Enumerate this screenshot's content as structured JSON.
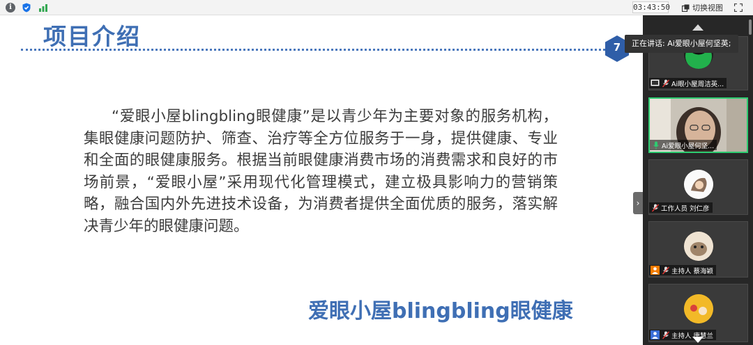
{
  "topbar": {
    "info_icon": "info-icon",
    "shield_icon": "shield-icon",
    "signal_icon": "signal-icon",
    "time": "03:43:50",
    "switch_view_label": "切换视图",
    "fullscreen_icon": "fullscreen-icon"
  },
  "slide": {
    "title": "项目介绍",
    "page_number": "7",
    "body": "“爱眼小屋blingbling眼健康”是以青少年为主要对象的服务机构，集眼健康问题防护、筛查、治疗等全方位服务于一身，提供健康、专业和全面的眼健康服务。根据当前眼健康消费市场的消费需求和良好的市场前景，“爱眼小屋”采用现代化管理模式，建立极具影响力的营销策略，融合国内外先进技术设备，为消费者提供全面优质的服务，落实解决青少年的眼健康问题。",
    "brand": "爱眼小屋blingbling眼健康",
    "colors": {
      "title": "#3f6fb4",
      "text": "#3c3c3c"
    }
  },
  "speaking": "正在讲话: Ai爱眼小屋何坚英;",
  "participants": [
    {
      "name": "Ai眼小屋周洁英...",
      "mic": "muted",
      "badge": "screen-share-icon"
    },
    {
      "name": "Ai爱眼小屋何坚...",
      "mic": "active",
      "badge": ""
    },
    {
      "name": "工作人员 刘仁彦",
      "mic": "muted",
      "badge": ""
    },
    {
      "name": "主持人 蔡海颖",
      "mic": "muted",
      "badge": "host-icon"
    },
    {
      "name": "主持人 唐慧兰",
      "mic": "muted",
      "badge": "user-icon"
    }
  ],
  "accent_color": "#2ecc71",
  "panel_color": "#272727"
}
